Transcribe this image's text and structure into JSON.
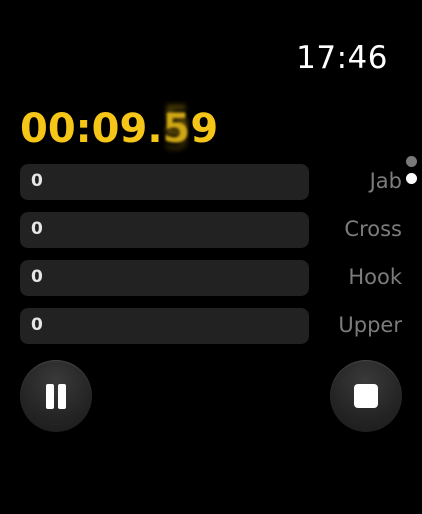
{
  "status": {
    "time": "17:46"
  },
  "timer": {
    "prefix": "00:09.",
    "rolling_digit": "5",
    "suffix": "9",
    "color": "#f5c518"
  },
  "pagination": {
    "pages": 2,
    "current": 2
  },
  "counters": [
    {
      "label": "Jab",
      "value": "0"
    },
    {
      "label": "Cross",
      "value": "0"
    },
    {
      "label": "Hook",
      "value": "0"
    },
    {
      "label": "Upper",
      "value": "0"
    }
  ],
  "controls": {
    "pause_icon": "pause-icon",
    "stop_icon": "stop-icon"
  }
}
